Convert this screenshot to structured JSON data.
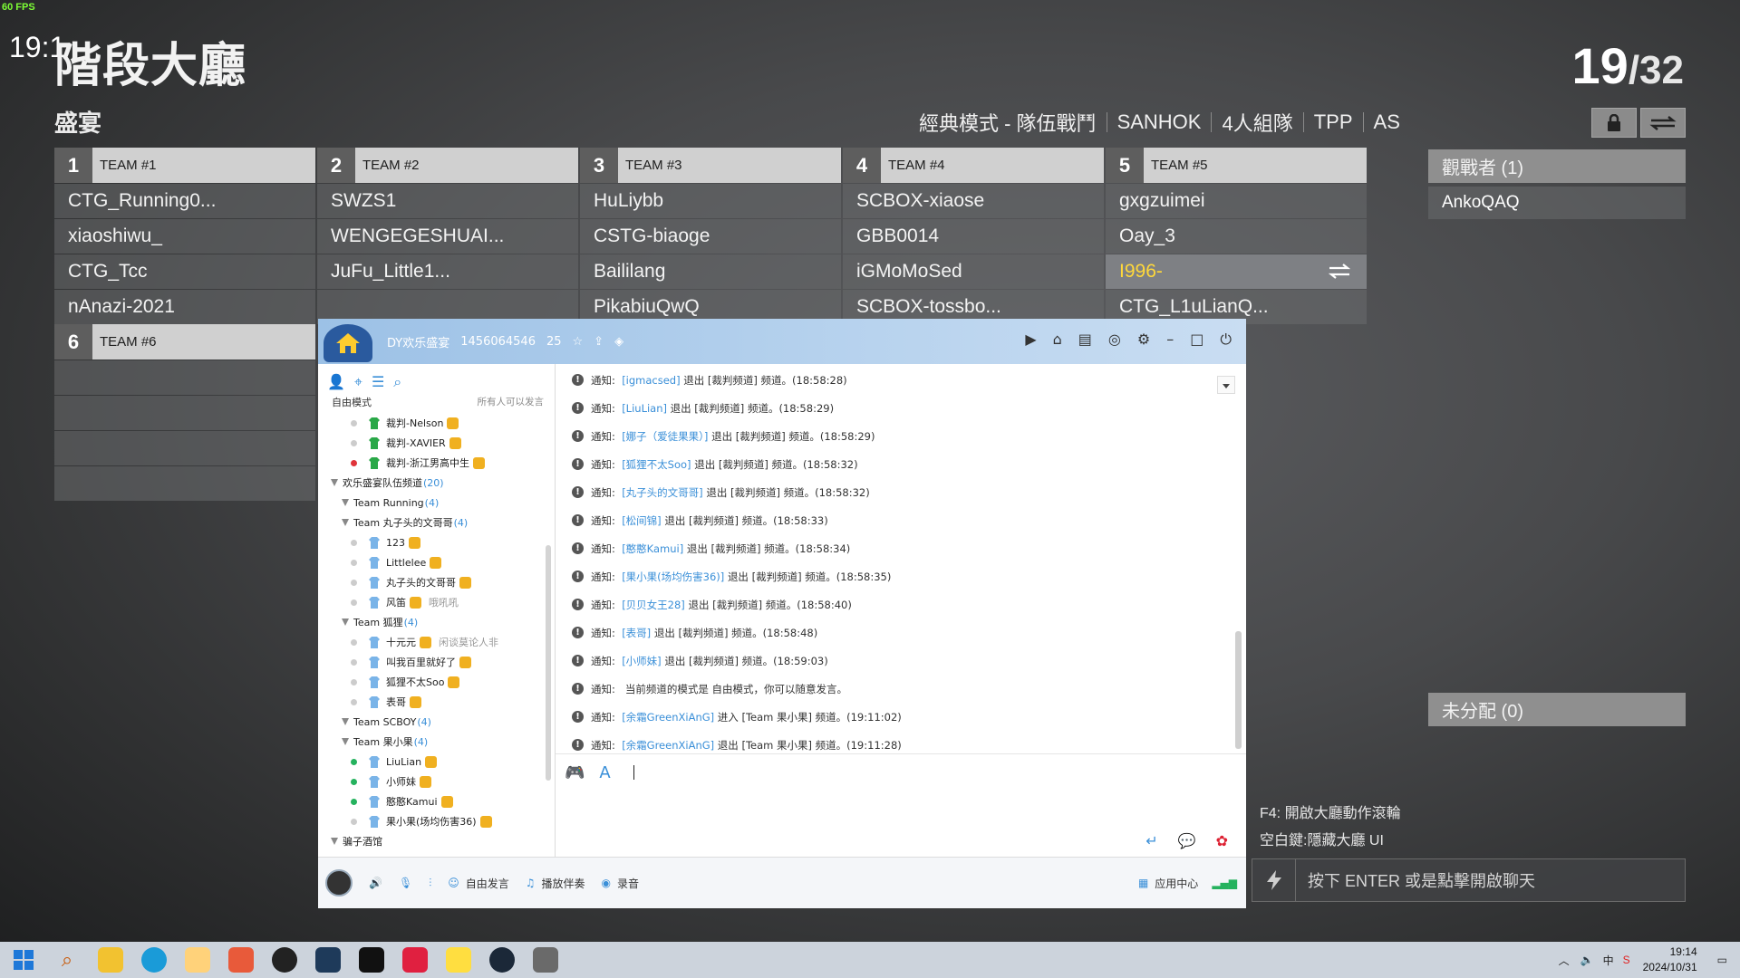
{
  "fps": "60 FPS",
  "clock_under": "19:1",
  "title": "階段大廳",
  "subtitle": "盛宴",
  "players": {
    "current": "19",
    "total": "/32"
  },
  "modes": [
    "經典模式 - 隊伍戰鬥",
    "SANHOK",
    "4人組隊",
    "TPP",
    "AS"
  ],
  "teams": [
    {
      "num": "1",
      "label": "TEAM #1",
      "players": [
        "CTG_Running0...",
        "xiaoshiwu_",
        "CTG_Tcc",
        "nAnazi-2021"
      ]
    },
    {
      "num": "2",
      "label": "TEAM #2",
      "players": [
        "SWZS1",
        "WENGEGESHUAI...",
        "JuFu_Little1...",
        ""
      ]
    },
    {
      "num": "3",
      "label": "TEAM #3",
      "players": [
        "HuLiybb",
        "CSTG-biaoge",
        "Baililang",
        "PikabiuQwQ"
      ]
    },
    {
      "num": "4",
      "label": "TEAM #4",
      "players": [
        "SCBOX-xiaose",
        "GBB0014",
        "iGMoMoSed",
        "SCBOX-tossbo..."
      ]
    },
    {
      "num": "5",
      "label": "TEAM #5",
      "players": [
        "gxgzuimei",
        "Oay_3",
        "I996-",
        "CTG_L1uLianQ..."
      ]
    },
    {
      "num": "6",
      "label": "TEAM #6",
      "players": [
        "",
        "",
        "",
        ""
      ]
    }
  ],
  "spectators": {
    "title": "觀戰者 (1)",
    "items": [
      "AnkoQAQ"
    ]
  },
  "unassigned": {
    "title": "未分配 (0)"
  },
  "hints": [
    "F4: 開啟大廳動作滾輪",
    "空白鍵:隱藏大廳 UI"
  ],
  "chat_placeholder": "按下 ENTER 或是點擊開啟聊天",
  "yy": {
    "channel_name": "DY欢乐盛宴",
    "channel_id": "1456064546",
    "online": "25",
    "mode": "自由模式",
    "mode_note": "所有人可以发言",
    "tree": [
      {
        "t": "user",
        "dot": "",
        "name": "裁判-Nelson"
      },
      {
        "t": "user",
        "dot": "",
        "name": "裁判-XAVIER"
      },
      {
        "t": "user",
        "dot": "red",
        "name": "裁判-浙江男高中生"
      },
      {
        "t": "group",
        "name": "欢乐盛宴队伍频道",
        "cnt": "(20)"
      },
      {
        "t": "sub",
        "name": "Team Running",
        "cnt": "(4)"
      },
      {
        "t": "sub",
        "name": "Team 丸子头的文哥哥",
        "cnt": "(4)"
      },
      {
        "t": "member",
        "dot": "",
        "name": "123"
      },
      {
        "t": "member",
        "dot": "",
        "name": "Littlelee"
      },
      {
        "t": "member",
        "dot": "",
        "name": "丸子头的文哥哥"
      },
      {
        "t": "member",
        "dot": "",
        "name": "风笛",
        "note": "哦吼吼"
      },
      {
        "t": "sub",
        "name": "Team 狐狸",
        "cnt": "(4)"
      },
      {
        "t": "member",
        "dot": "",
        "name": "十元元",
        "note": "闲谈莫论人非"
      },
      {
        "t": "member",
        "dot": "",
        "name": "叫我百里就好了"
      },
      {
        "t": "member",
        "dot": "",
        "name": "狐狸不太Soo"
      },
      {
        "t": "member",
        "dot": "",
        "name": "表哥"
      },
      {
        "t": "sub",
        "name": "Team SCBOY",
        "cnt": "(4)"
      },
      {
        "t": "sub",
        "name": "Team 果小果",
        "cnt": "(4)"
      },
      {
        "t": "member",
        "dot": "green",
        "name": "LiuLian"
      },
      {
        "t": "member",
        "dot": "green",
        "name": "小师妹"
      },
      {
        "t": "member",
        "dot": "green",
        "name": "憨憨Kamui"
      },
      {
        "t": "member",
        "dot": "",
        "name": "果小果(场均伤害36)"
      },
      {
        "t": "group",
        "name": "骗子酒馆",
        "cnt": ""
      }
    ],
    "messages": [
      {
        "p": "通知:",
        "u": "[igmacsed]",
        "r": "退出 [裁判频道] 频道。(18:58:28)"
      },
      {
        "p": "通知:",
        "u": "[LiuLian]",
        "r": "退出 [裁判频道] 频道。(18:58:29)"
      },
      {
        "p": "通知:",
        "u": "[娜子（爱徒果果）]",
        "r": "退出 [裁判频道] 频道。(18:58:29)"
      },
      {
        "p": "通知:",
        "u": "[狐狸不太Soo]",
        "r": "退出 [裁判频道] 频道。(18:58:32)"
      },
      {
        "p": "通知:",
        "u": "[丸子头的文哥哥]",
        "r": "退出 [裁判频道] 频道。(18:58:32)"
      },
      {
        "p": "通知:",
        "u": "[松间锦]",
        "r": "退出 [裁判频道] 频道。(18:58:33)"
      },
      {
        "p": "通知:",
        "u": "[憨憨Kamui]",
        "r": "退出 [裁判频道] 频道。(18:58:34)"
      },
      {
        "p": "通知:",
        "u": "[果小果(场均伤害36)]",
        "r": "退出 [裁判频道] 频道。(18:58:35)"
      },
      {
        "p": "通知:",
        "u": "[贝贝女王28]",
        "r": "退出 [裁判频道] 频道。(18:58:40)"
      },
      {
        "p": "通知:",
        "u": "[表哥]",
        "r": "退出 [裁判频道] 频道。(18:58:48)"
      },
      {
        "p": "通知:",
        "u": "[小师妹]",
        "r": "退出 [裁判频道] 频道。(18:59:03)"
      },
      {
        "p": "通知:",
        "u": "",
        "r": "当前频道的模式是 自由模式，你可以随意发言。"
      },
      {
        "p": "通知:",
        "u": "[余霜GreenXiAnG]",
        "r": "进入 [Team 果小果] 频道。(19:11:02)"
      },
      {
        "p": "通知:",
        "u": "[余霜GreenXiAnG]",
        "r": "退出 [Team 果小果] 频道。(19:11:28)"
      }
    ],
    "bottom": {
      "free_speak": "自由发言",
      "play": "播放伴奏",
      "record": "录音",
      "app_center": "应用中心"
    }
  },
  "taskbar": {
    "time": "19:14",
    "date": "2024/10/31"
  }
}
